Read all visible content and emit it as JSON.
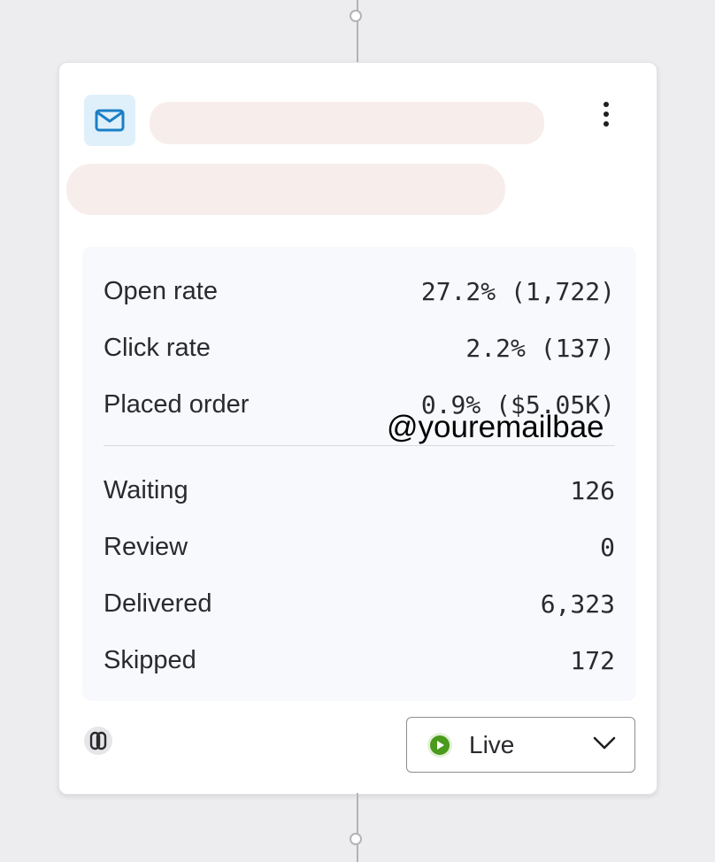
{
  "card": {
    "icon": "email-icon",
    "menu_icon": "more-vertical-icon",
    "metrics": [
      {
        "label": "Open rate",
        "value": "27.2% (1,722)"
      },
      {
        "label": "Click rate",
        "value": "2.2% (137)"
      },
      {
        "label": "Placed order",
        "value": "0.9% ($5.05K)"
      }
    ],
    "counts": [
      {
        "label": "Waiting",
        "value": "126"
      },
      {
        "label": "Review",
        "value": "0"
      },
      {
        "label": "Delivered",
        "value": "6,323"
      },
      {
        "label": "Skipped",
        "value": "172"
      }
    ],
    "footer": {
      "link_icon": "link-icon",
      "status_label": "Live",
      "status_icon": "play-circle-icon",
      "status_color": "#4a9a1c"
    }
  },
  "watermark": "@youremailbae",
  "colors": {
    "accent_blue": "#1b7fc4",
    "icon_bg": "#dff0fb",
    "stats_bg": "#f7f9fc"
  }
}
